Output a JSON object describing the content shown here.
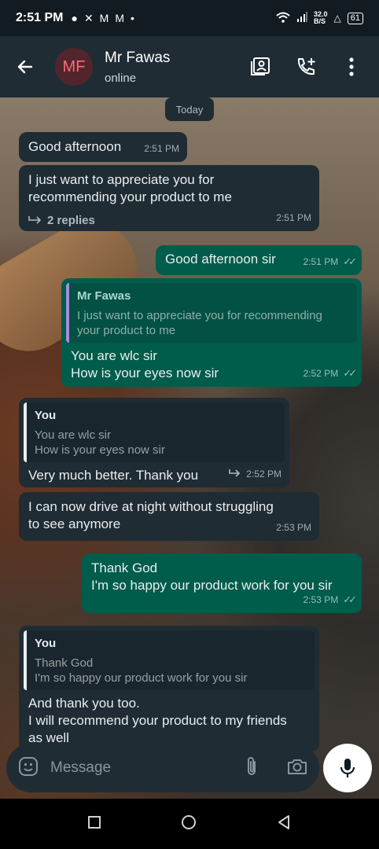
{
  "status_bar": {
    "time": "2:51 PM",
    "speed": "32.0",
    "speed_unit": "B/S",
    "battery": "61"
  },
  "header": {
    "avatar_initials": "MF",
    "name": "Mr Fawas",
    "status": "online"
  },
  "chat": {
    "date_chip": "Today",
    "messages": [
      {
        "text": "Good afternoon",
        "time": "2:51 PM"
      },
      {
        "text_line1": "I just want to appreciate you for",
        "text_line2": "recommending your product to me",
        "replies": "2 replies",
        "time": "2:51 PM"
      },
      {
        "text": "Good afternoon sir",
        "time": "2:51 PM"
      },
      {
        "quote_author": "Mr Fawas",
        "quote_line1": "I just want to appreciate you for recommending",
        "quote_line2": "your product to me",
        "text_line1": "You are wlc sir",
        "text_line2": "How is your eyes now sir",
        "time": "2:52 PM"
      },
      {
        "quote_author": "You",
        "quote_line1": "You are wlc sir",
        "quote_line2": "How is your eyes now sir",
        "text": "Very much better. Thank you",
        "time": "2:52 PM"
      },
      {
        "text_line1": "I can now drive at night without struggling",
        "text_line2": "to see anymore",
        "time": "2:53 PM"
      },
      {
        "text_line1": "Thank God",
        "text_line2": "I'm so happy our product work for you sir",
        "time": "2:53 PM"
      },
      {
        "quote_author": "You",
        "quote_line1": "Thank God",
        "quote_line2": "I'm so happy our product work for you sir",
        "text_line1": "And thank you too.",
        "text_line2": "I will recommend your product to my friends",
        "text_line3": "as well"
      }
    ]
  },
  "input": {
    "placeholder": "Message"
  },
  "icons": {
    "back": "arrow-left-icon",
    "contacts": "contact-card-icon",
    "add_call": "phone-plus-icon",
    "menu": "more-vertical-icon",
    "emoji": "emoji-icon",
    "attach": "paperclip-icon",
    "camera": "camera-icon",
    "mic": "mic-icon"
  },
  "colors": {
    "incoming_bubble": "#1f2c34",
    "outgoing_bubble": "#005c4b",
    "header": "#1f2c34"
  }
}
